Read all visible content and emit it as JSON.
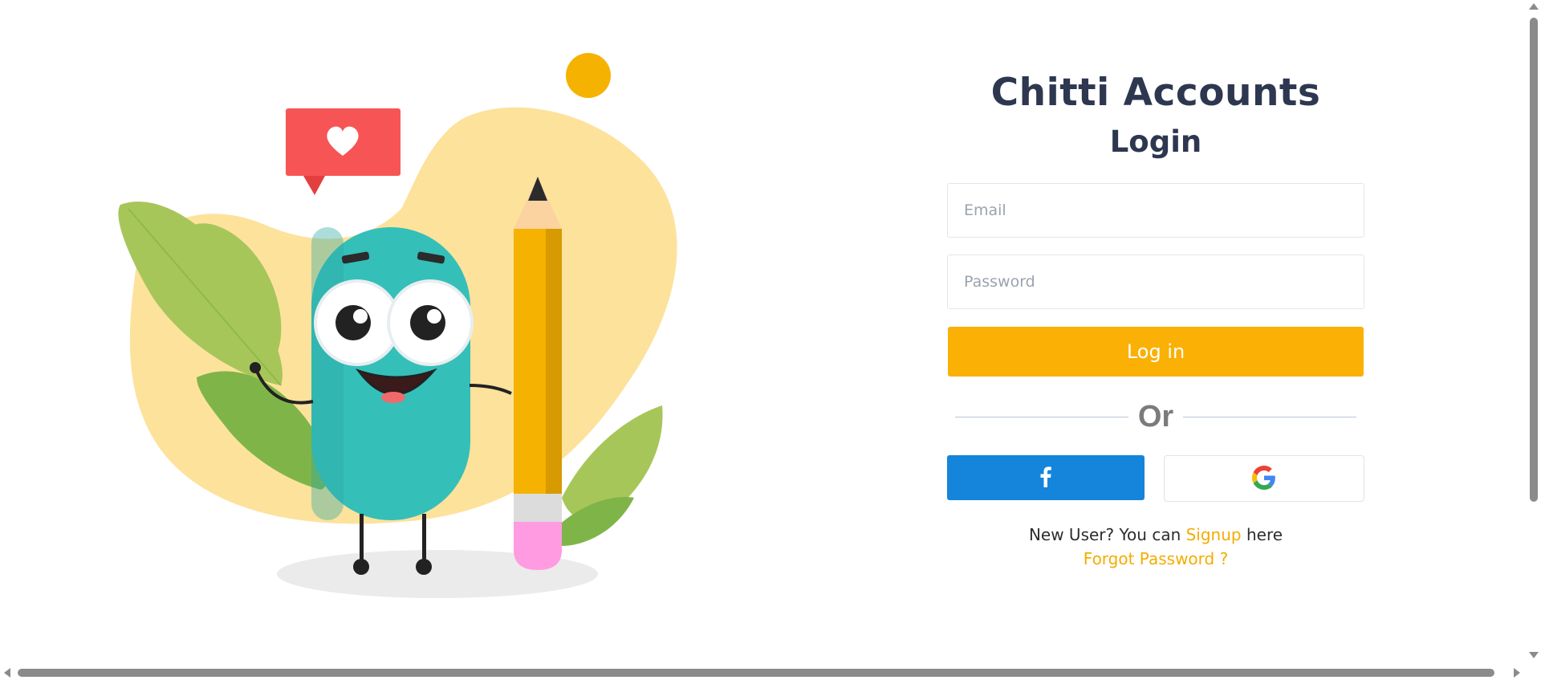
{
  "app": {
    "brand_title": "Chitti Accounts",
    "login_title": "Login"
  },
  "form": {
    "email_placeholder": "Email",
    "email_value": "",
    "password_placeholder": "Password",
    "password_value": "",
    "login_label": "Log in",
    "or_label": "Or"
  },
  "social": {
    "facebook_icon": "facebook-icon",
    "google_icon": "google-icon"
  },
  "footer": {
    "new_user_prefix": "New User? You can ",
    "signup_link": "Signup",
    "new_user_suffix": " here",
    "forgot_password_link": "Forgot Password ?"
  },
  "colors": {
    "accent": "#fab005",
    "facebook": "#1485db",
    "title": "#2d3750",
    "link": "#f5ac00"
  },
  "illustration": {
    "description_icon": "cartoon-character-with-pencil-illustration"
  }
}
